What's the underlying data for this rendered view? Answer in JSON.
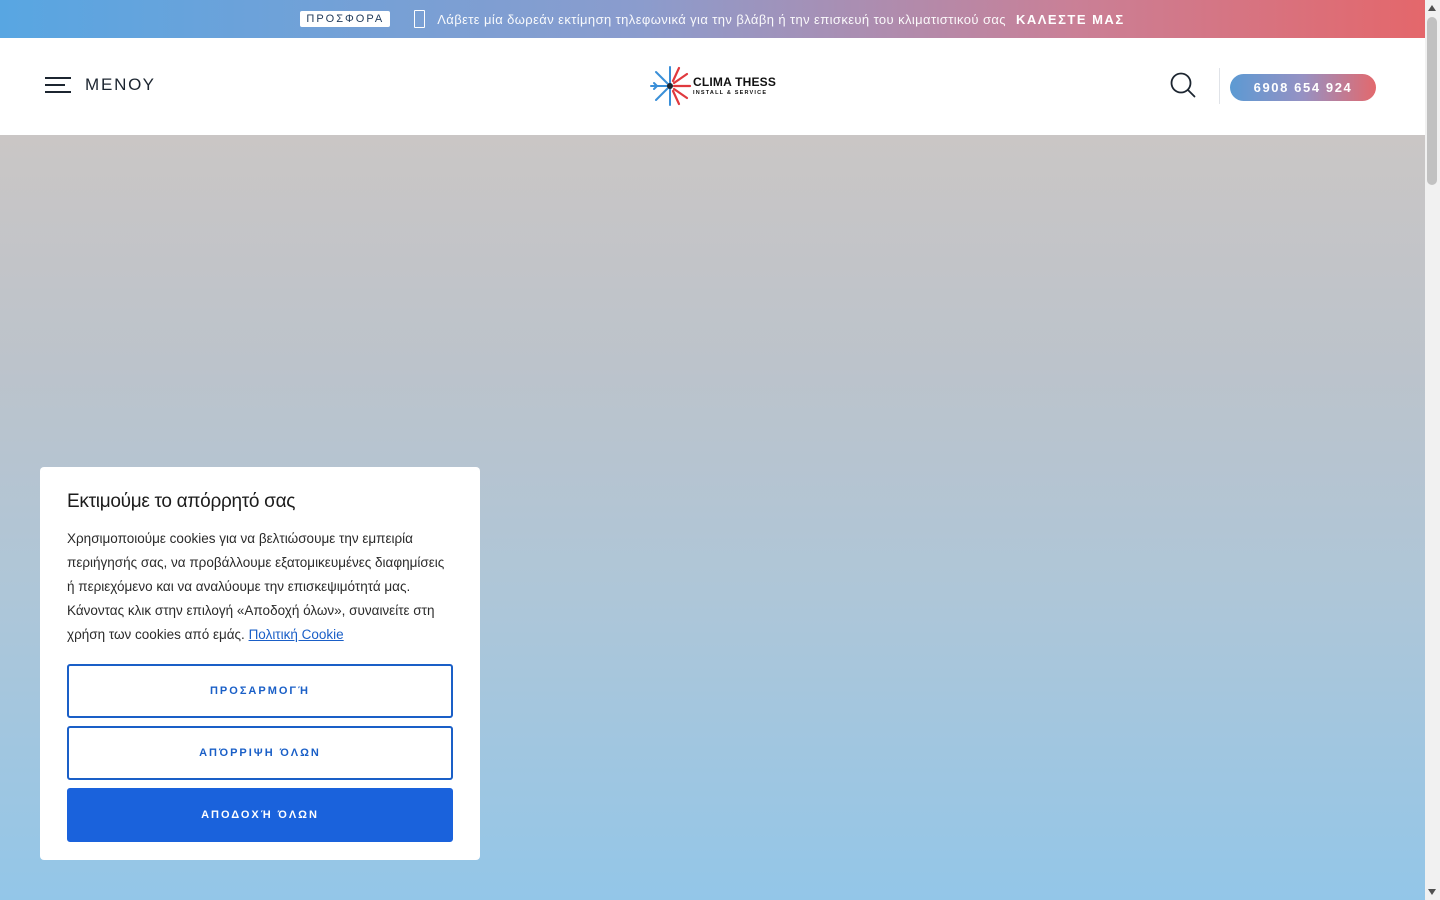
{
  "topbar": {
    "badge": "ΠΡΟΣΦΟΡΑ",
    "message": "Λάβετε μία δωρεάν εκτίμηση τηλεφωνικά για την βλάβη ή την επισκευή του κλιματιστικού σας",
    "cta": "ΚΑΛΕΣΤΕ ΜΑΣ",
    "icon": "phone-icon"
  },
  "header": {
    "menu_label": "ΜΕΝΟΥ",
    "logo_name": "CLIMA THESS",
    "logo_sub": "INSTALL & SERVICE",
    "phone": "6908 654 924"
  },
  "cookie": {
    "title": "Εκτιμούμε το απόρρητό σας",
    "text": "Χρησιμοποιούμε cookies για να βελτιώσουμε την εμπειρία περιήγησής σας, να προβάλλουμε εξατομικευμένες διαφημίσεις ή περιεχόμενο και να αναλύουμε την επισκεψιμότητά μας. Κάνοντας κλικ στην επιλογή «Αποδοχή όλων», συναινείτε στη χρήση των cookies από εμάς. ",
    "link": "Πολιτική Cookie",
    "customize": "ΠΡΟΣΑΡΜΟΓΉ",
    "reject": "ΑΠΌΡΡΙΨΗ ΌΛΩΝ",
    "accept": "ΑΠΟΔΟΧΉ ΌΛΩΝ"
  },
  "colors": {
    "accent_blue": "#1a62dc",
    "brand_red": "#e4676b",
    "brand_blue": "#58a6e2"
  }
}
